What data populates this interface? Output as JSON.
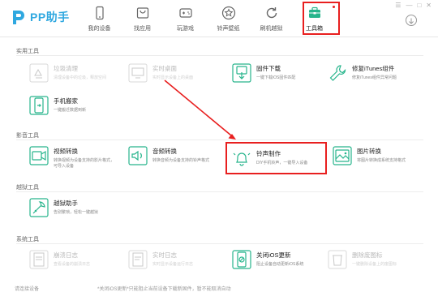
{
  "app": {
    "logo_text": "PP助手"
  },
  "nav": {
    "items": [
      {
        "label": "我的设备",
        "icon": "phone-icon"
      },
      {
        "label": "找应用",
        "icon": "bag-icon"
      },
      {
        "label": "玩游戏",
        "icon": "gamepad-icon"
      },
      {
        "label": "铃声壁纸",
        "icon": "star-icon"
      },
      {
        "label": "刷机越狱",
        "icon": "refresh-icon"
      },
      {
        "label": "工具箱",
        "icon": "toolbox-icon",
        "active": true
      }
    ]
  },
  "sections": {
    "practical": {
      "title": "实用工具"
    },
    "media": {
      "title": "影音工具"
    },
    "jailbreak": {
      "title": "越狱工具"
    },
    "system": {
      "title": "系统工具"
    }
  },
  "tools": {
    "junk_clean": {
      "name": "垃圾清理",
      "desc": "清理设备中的垃圾，释放空间"
    },
    "live_desktop": {
      "name": "实时桌面",
      "desc": "实时显示设备上的桌面"
    },
    "firmware_download": {
      "name": "固件下载",
      "desc": "一键下载iOS固件匹配"
    },
    "fix_itunes": {
      "name": "修复iTunes组件",
      "desc": "修复iTunes组件异常问题"
    },
    "phone_move": {
      "name": "手机搬家",
      "desc": "一键搬迁数据到新"
    },
    "video_convert": {
      "name": "视频转换",
      "desc": "转换视频为设备支持的影片格式，\n可导入设备"
    },
    "audio_convert": {
      "name": "音频转换",
      "desc": "转换音频为设备支持的铃声格式"
    },
    "ringtone_make": {
      "name": "铃声制作",
      "desc": "DIY手机铃声，一键导入设备"
    },
    "image_convert": {
      "name": "图片转换",
      "desc": "将图片转换成系统支持格式"
    },
    "jailbreak_helper": {
      "name": "越狱助手",
      "desc": "告别繁琐，轻松一键越狱"
    },
    "crash_log": {
      "name": "崩溃日志",
      "desc": "查看设备的崩溃日志"
    },
    "realtime_log": {
      "name": "实时日志",
      "desc": "实时显示设备运行日志"
    },
    "close_ios_update": {
      "name": "关闭iOS更新",
      "desc": "阻止设备自动更新iOS系统"
    },
    "delete_useless_icon": {
      "name": "删除废图标",
      "desc": "一键删除设备上的废图标"
    }
  },
  "footer": {
    "left": "请连接设备",
    "center": "*关闭iOS更新*只能阻止当前设备下载新固件，暂不能取消自动"
  },
  "colors": {
    "accent": "#2fa8e0",
    "green": "#27b58c",
    "highlight": "#e81f1f"
  }
}
